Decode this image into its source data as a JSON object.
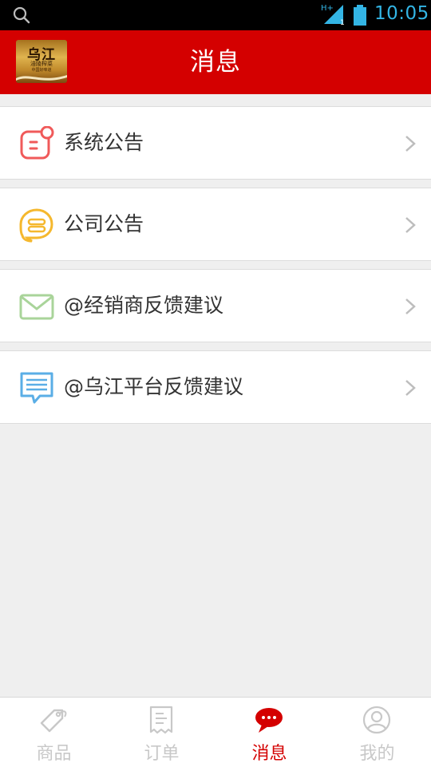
{
  "status_bar": {
    "network": "H+",
    "sim_slot": "1",
    "time": "10:05"
  },
  "header": {
    "title": "消息",
    "logo": {
      "brand": "乌江",
      "line1": "涪陵榨菜",
      "line2": "中国好味道"
    }
  },
  "messages": [
    {
      "label": "系统公告",
      "icon": "announcement-icon",
      "color": "#f05a5a"
    },
    {
      "label": "公司公告",
      "icon": "chat-bubble-icon",
      "color": "#f5b82e"
    },
    {
      "label": "@经销商反馈建议",
      "icon": "envelope-icon",
      "color": "#a9d49a"
    },
    {
      "label": "@乌江平台反馈建议",
      "icon": "message-lines-icon",
      "color": "#5aaee6"
    }
  ],
  "tabs": [
    {
      "label": "商品",
      "icon": "tag-icon",
      "active": false
    },
    {
      "label": "订单",
      "icon": "receipt-icon",
      "active": false
    },
    {
      "label": "消息",
      "icon": "speech-bubble-icon",
      "active": true
    },
    {
      "label": "我的",
      "icon": "user-icon",
      "active": false
    }
  ],
  "colors": {
    "brand_red": "#d40000",
    "status_blue": "#33b5e5",
    "inactive_tab": "#c8c8c8"
  }
}
